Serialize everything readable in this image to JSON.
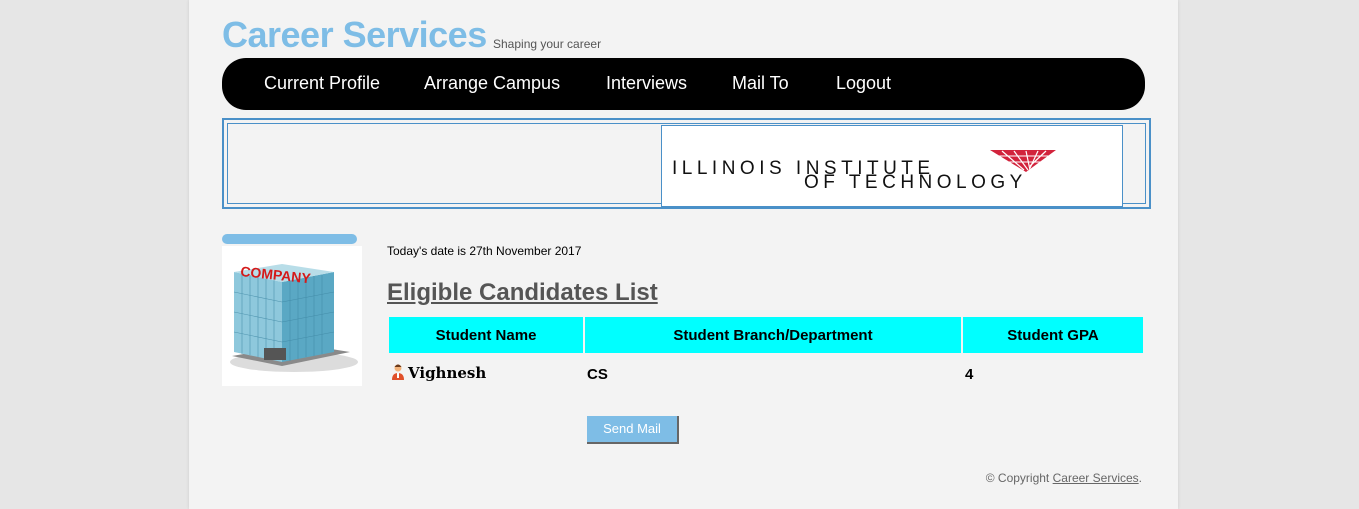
{
  "header": {
    "site_title": "Career Services",
    "tagline": "Shaping your career"
  },
  "nav": {
    "items": [
      {
        "label": "Current Profile"
      },
      {
        "label": "Arrange Campus"
      },
      {
        "label": "Interviews"
      },
      {
        "label": "Mail To"
      },
      {
        "label": "Logout"
      }
    ]
  },
  "banner": {
    "logo_line1": "ILLINOIS INSTITUTE",
    "logo_line2": "OF TECHNOLOGY",
    "logo_color": "#d2233c"
  },
  "sidebar": {
    "image_label": "COMPANY"
  },
  "main": {
    "date_text": "Today's date is 27th November 2017",
    "heading": "Eligible Candidates List",
    "table": {
      "headers": [
        "Student Name",
        "Student Branch/Department",
        "Student GPA"
      ],
      "rows": [
        {
          "name": "Vighnesh",
          "branch": "CS",
          "gpa": "4"
        }
      ]
    },
    "send_button": "Send Mail"
  },
  "footer": {
    "copyright_prefix": "© Copyright",
    "copyright_link": "Career Services",
    "copyright_suffix": "."
  },
  "colors": {
    "accent": "#7ebde6",
    "nav_bg": "#000000",
    "table_header": "#00ffff",
    "border_blue": "#4a90c8"
  }
}
